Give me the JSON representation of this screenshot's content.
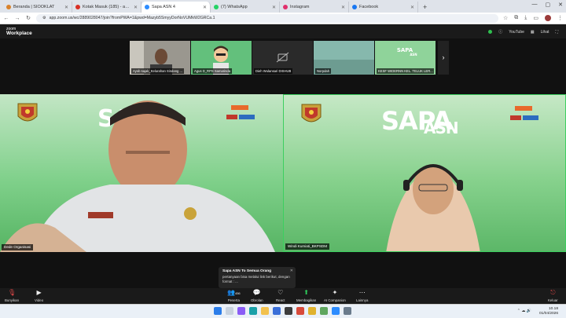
{
  "browser": {
    "tabs": [
      {
        "label": "Beranda | SIOOKLAT",
        "color": "#d9822b"
      },
      {
        "label": "Kotak Masuk (185) - ayahsajid…",
        "color": "#d93025"
      },
      {
        "label": "Sapa ASN 4",
        "color": "#2d8cff",
        "active": true
      },
      {
        "label": "(7) WhatsApp",
        "color": "#25d366"
      },
      {
        "label": "Instagram",
        "color": "#e1306c"
      },
      {
        "label": "Facebook",
        "color": "#1877f2"
      }
    ],
    "new_tab": "+",
    "url": "app.zoom.us/wc/2889028047/join?fromPWA=1&pwd=Mazyb5SmyyDorNoVUMkW2GRCa.1",
    "window_controls": [
      "—",
      "▢",
      "✕"
    ]
  },
  "zoom": {
    "logo_top": "zoom",
    "logo_bottom": "Workplace",
    "view_label": "YouTube",
    "view_mode": "Lihat"
  },
  "thumbnails": [
    {
      "name": "Ayob sajak_Kelurahan Sindang ...",
      "bg": "#8c8a86"
    },
    {
      "name": "Agus D_RPS Samarinda",
      "bg": "#5fbf7a"
    },
    {
      "name": "Dieh Wulansari DISHUB",
      "bg": "#2a2a2a"
    },
    {
      "name": "Norpdah",
      "bg": "#7fb0a6"
    },
    {
      "name": "KESF WIDERNN KEL. TELUK LER...",
      "bg": "#86cf92"
    }
  ],
  "main_tiles": [
    {
      "name": "Dede Organisasi",
      "brand_text": "SA"
    },
    {
      "name": "Windi Kumiati_BKPSDM",
      "brand_text": "SAPA",
      "brand_text2": "ASN"
    }
  ],
  "chat_popup": {
    "title": "Sapa ASN To Semua Orang",
    "message": "pertanyaan bisa melalui link berikut, dengan format : ..."
  },
  "toolbar": {
    "left": [
      {
        "label": "Bunyikan",
        "icon": "microphone-icon"
      },
      {
        "label": "Video",
        "icon": "video-icon"
      }
    ],
    "center": [
      {
        "label": "Peserta",
        "icon": "participants-icon",
        "count": "456"
      },
      {
        "label": "Obrolan",
        "icon": "chat-icon"
      },
      {
        "label": "React",
        "icon": "heart-icon"
      },
      {
        "label": "Membagikan",
        "icon": "share-icon"
      },
      {
        "label": "AI Companion",
        "icon": "sparkle-icon"
      },
      {
        "label": "Lainnya",
        "icon": "more-icon"
      }
    ],
    "right": {
      "label": "Keluar",
      "icon": "leave-icon"
    }
  },
  "taskbar": {
    "time": "10.18",
    "date": "01/04/2026"
  }
}
